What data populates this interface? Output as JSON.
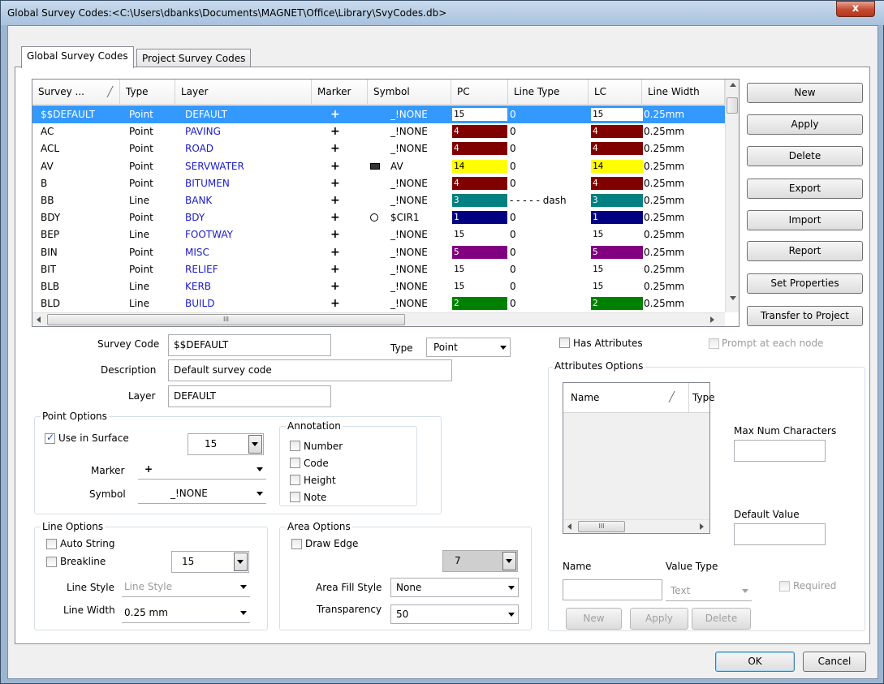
{
  "window": {
    "title": "Global Survey Codes:<C:\\Users\\dbanks\\Documents\\MAGNET\\Office\\Library\\SvyCodes.db>",
    "close_glyph": "x"
  },
  "tabs": [
    {
      "label": "Global Survey Codes"
    },
    {
      "label": "Project Survey Codes"
    }
  ],
  "grid": {
    "headers": [
      "Survey ...",
      "Type",
      "Layer",
      "Marker",
      "Symbol",
      "PC",
      "Line Type",
      "LC",
      "Line Width"
    ],
    "rows": [
      {
        "code": "$$DEFAULT",
        "type": "Point",
        "layer": "DEFAULT",
        "marker": "+",
        "symbol": "_!NONE",
        "pc": "15",
        "pc_color": "#ffffff",
        "line_type": "0",
        "lc": "15",
        "lc_color": "#ffffff",
        "width": "0.25mm"
      },
      {
        "code": "AC",
        "type": "Point",
        "layer": "PAVING",
        "marker": "+",
        "symbol": "_!NONE",
        "pc": "4",
        "pc_color": "#800000",
        "line_type": "0",
        "lc": "4",
        "lc_color": "#800000",
        "width": "0.25mm"
      },
      {
        "code": "ACL",
        "type": "Point",
        "layer": "ROAD",
        "marker": "+",
        "symbol": "_!NONE",
        "pc": "4",
        "pc_color": "#800000",
        "line_type": "0",
        "lc": "4",
        "lc_color": "#800000",
        "width": "0.25mm"
      },
      {
        "code": "AV",
        "type": "Point",
        "layer": "SERVWATER",
        "marker": "+",
        "symbol": "AV",
        "pc": "14",
        "pc_color": "#ffff00",
        "line_type": "0",
        "lc": "14",
        "lc_color": "#ffff00",
        "width": "0.25mm"
      },
      {
        "code": "B",
        "type": "Point",
        "layer": "BITUMEN",
        "marker": "+",
        "symbol": "_!NONE",
        "pc": "4",
        "pc_color": "#800000",
        "line_type": "0",
        "lc": "4",
        "lc_color": "#800000",
        "width": "0.25mm"
      },
      {
        "code": "BB",
        "type": "Line",
        "layer": "BANK",
        "marker": "+",
        "symbol": "_!NONE",
        "pc": "3",
        "pc_color": "#008080",
        "line_type": "- - - - -  dash",
        "lc": "3",
        "lc_color": "#008080",
        "width": "0.25mm"
      },
      {
        "code": "BDY",
        "type": "Point",
        "layer": "BDY",
        "marker": "+",
        "symbol": "$CIR1",
        "pc": "1",
        "pc_color": "#000080",
        "line_type": "0",
        "lc": "1",
        "lc_color": "#000080",
        "width": "0.25mm"
      },
      {
        "code": "BEP",
        "type": "Line",
        "layer": "FOOTWAY",
        "marker": "+",
        "symbol": "_!NONE",
        "pc": "15",
        "pc_color": "#ffffff",
        "line_type": "0",
        "lc": "15",
        "lc_color": "#ffffff",
        "width": "0.25mm"
      },
      {
        "code": "BIN",
        "type": "Point",
        "layer": "MISC",
        "marker": "+",
        "symbol": "_!NONE",
        "pc": "5",
        "pc_color": "#800080",
        "line_type": "0",
        "lc": "5",
        "lc_color": "#800080",
        "width": "0.25mm"
      },
      {
        "code": "BIT",
        "type": "Point",
        "layer": "RELIEF",
        "marker": "+",
        "symbol": "_!NONE",
        "pc": "15",
        "pc_color": "#ffffff",
        "line_type": "0",
        "lc": "15",
        "lc_color": "#ffffff",
        "width": "0.25mm"
      },
      {
        "code": "BLB",
        "type": "Line",
        "layer": "KERB",
        "marker": "+",
        "symbol": "_!NONE",
        "pc": "15",
        "pc_color": "#ffffff",
        "line_type": "0",
        "lc": "15",
        "lc_color": "#ffffff",
        "width": "0.25mm"
      },
      {
        "code": "BLD",
        "type": "Line",
        "layer": "BUILD",
        "marker": "+",
        "symbol": "_!NONE",
        "pc": "2",
        "pc_color": "#008000",
        "line_type": "0",
        "lc": "2",
        "lc_color": "#008000",
        "width": "0.25mm"
      }
    ]
  },
  "side_buttons": [
    "New",
    "Apply",
    "Delete",
    "Export",
    "Import",
    "Report",
    "Set Properties",
    "Transfer to Project"
  ],
  "form": {
    "survey_code_label": "Survey Code",
    "survey_code_value": "$$DEFAULT",
    "type_label": "Type",
    "type_value": "Point",
    "description_label": "Description",
    "description_value": "Default survey code",
    "layer_label": "Layer",
    "layer_value": "DEFAULT"
  },
  "point_options": {
    "title": "Point Options",
    "use_in_surface": "Use in Surface",
    "use_in_surface_checked": true,
    "color_value": "15",
    "marker_label": "Marker",
    "marker_value": "+",
    "symbol_label": "Symbol",
    "symbol_value": "_!NONE"
  },
  "annotation": {
    "title": "Annotation",
    "items": [
      "Number",
      "Code",
      "Height",
      "Note"
    ]
  },
  "line_options": {
    "title": "Line Options",
    "auto_string": "Auto String",
    "breakline": "Breakline",
    "color_value": "15",
    "line_style_label": "Line Style",
    "line_style_value": "Line Style",
    "line_width_label": "Line Width",
    "line_width_value": "0.25 mm"
  },
  "area_options": {
    "title": "Area Options",
    "draw_edge": "Draw Edge",
    "color_value": "7",
    "fill_style_label": "Area Fill Style",
    "fill_style_value": "None",
    "transparency_label": "Transparency",
    "transparency_value": "50"
  },
  "attributes": {
    "has_attributes": "Has Attributes",
    "prompt_each_node": "Prompt at each node",
    "options_title": "Attributes Options",
    "col_name": "Name",
    "col_type": "Type",
    "max_num_chars_label": "Max Num Characters",
    "default_value_label": "Default Value",
    "name_label": "Name",
    "value_type_label": "Value Type",
    "value_type_value": "Text",
    "required_label": "Required",
    "new_btn": "New",
    "apply_btn": "Apply",
    "delete_btn": "Delete"
  },
  "footer": {
    "ok": "OK",
    "cancel": "Cancel"
  },
  "scroll_glyph": "III"
}
